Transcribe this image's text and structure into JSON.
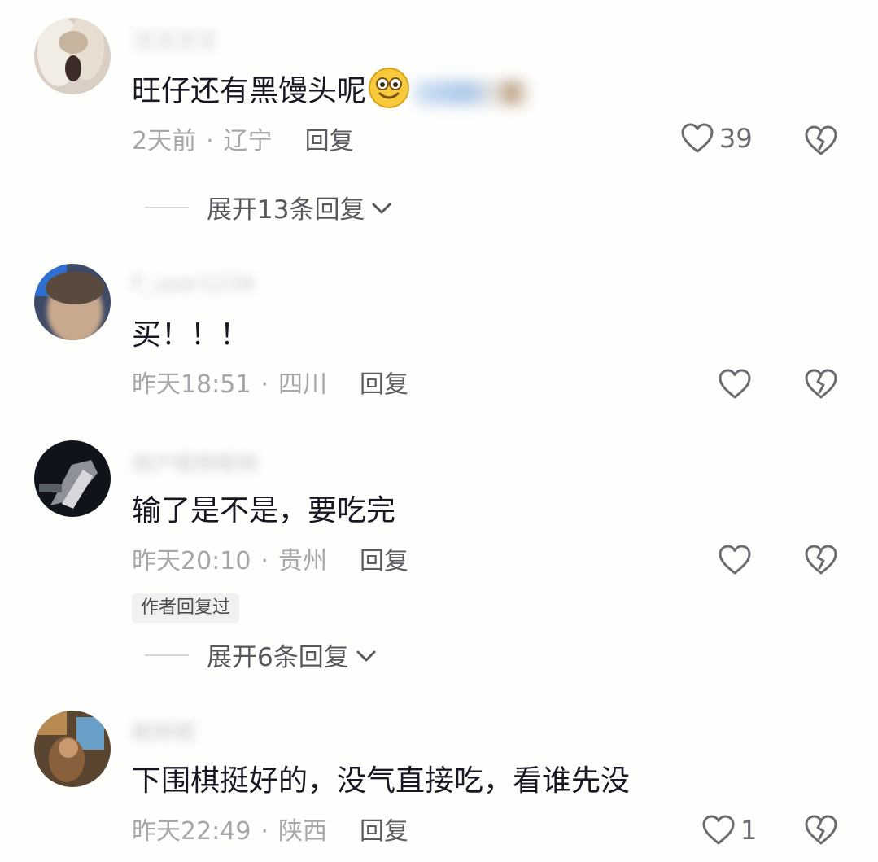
{
  "comments": [
    {
      "username": "汪汪汪汪",
      "text": "旺仔还有黑馒头呢",
      "time": "2天前",
      "location": "辽宁",
      "reply_label": "回复",
      "likes": "39",
      "expand_label": "展开13条回复"
    },
    {
      "username": "F_user1234",
      "text": "买！！！",
      "time": "昨天18:51",
      "location": "四川",
      "reply_label": "回复",
      "likes": ""
    },
    {
      "username": "用户昵称昵称",
      "text": "输了是不是，要吃完",
      "time": "昨天20:10",
      "location": "贵州",
      "reply_label": "回复",
      "likes": "",
      "badge": "作者回复过",
      "expand_label": "展开6条回复"
    },
    {
      "username": "昵称昵",
      "text": "下围棋挺好的，没气直接吃，看谁先没",
      "time": "昨天22:49",
      "location": "陕西",
      "reply_label": "回复",
      "likes": "1"
    }
  ],
  "separator": "·",
  "icons": {
    "like": "heart-outline-icon",
    "dislike": "broken-heart-icon",
    "expand": "chevron-down-icon",
    "emoji": "smiley-emoji-icon"
  },
  "colors": {
    "text": "#161823",
    "meta": "#a7a7ab",
    "reply": "#5c5c62",
    "icon": "#6b6b70"
  }
}
